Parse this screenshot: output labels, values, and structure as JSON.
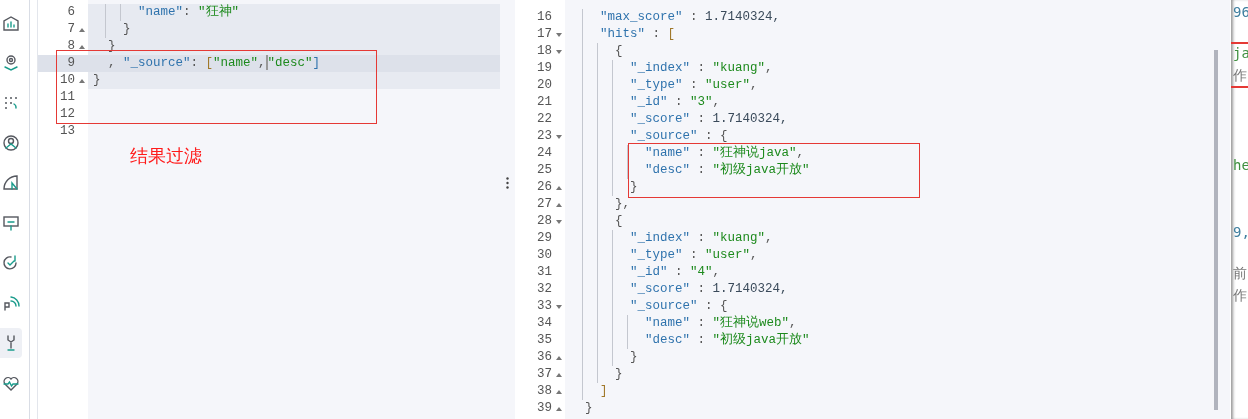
{
  "sidebar": {
    "items": [
      {
        "selected": false
      },
      {
        "selected": false
      },
      {
        "selected": false
      },
      {
        "selected": false
      },
      {
        "selected": false
      },
      {
        "selected": false
      },
      {
        "selected": false
      },
      {
        "selected": false
      },
      {
        "selected": true
      },
      {
        "selected": false
      }
    ]
  },
  "request_editor": {
    "lines": [
      {
        "number": "6",
        "in_request": true,
        "active": false,
        "tokens": [
          {
            "kind": "key",
            "text": "      \"name\""
          },
          {
            "kind": "punct",
            "text": ": "
          },
          {
            "kind": "string",
            "text": "\"狂神\""
          }
        ]
      },
      {
        "number": "7",
        "expanded": false,
        "in_request": true,
        "active": false,
        "tokens": [
          {
            "kind": "punct",
            "text": "    }"
          }
        ]
      },
      {
        "number": "8",
        "expanded": false,
        "in_request": true,
        "active": false,
        "tokens": [
          {
            "kind": "punct",
            "text": "  }"
          }
        ]
      },
      {
        "number": "9",
        "in_request": true,
        "active": true,
        "tokens": [
          {
            "kind": "punct",
            "text": "  , "
          },
          {
            "kind": "key",
            "text": "\"_source\""
          },
          {
            "kind": "punct",
            "text": ": "
          },
          {
            "kind": "bracket",
            "text": "["
          },
          {
            "kind": "string",
            "text": "\"name\""
          },
          {
            "kind": "punct",
            "text": ","
          },
          {
            "kind": "cursor"
          },
          {
            "kind": "string",
            "text": "\"desc\""
          },
          {
            "kind": "key",
            "text": "]"
          }
        ]
      },
      {
        "number": "10",
        "expanded": false,
        "in_request": true,
        "active": false,
        "tokens": [
          {
            "kind": "punct",
            "text": "}"
          }
        ]
      },
      {
        "number": "11",
        "in_request": false,
        "active": false
      },
      {
        "number": "12",
        "in_request": false,
        "active": false
      },
      {
        "number": "13",
        "in_request": false,
        "active": false
      }
    ],
    "note": "结果过滤"
  },
  "response_viewer": {
    "lines": [
      {
        "number": "16",
        "tokens": [
          {
            "kind": "key",
            "text": "    \"max_score\""
          },
          {
            "kind": "punct",
            "text": " : "
          },
          {
            "kind": "number",
            "text": "1.7140324,"
          }
        ]
      },
      {
        "number": "17",
        "expanded": true,
        "tokens": [
          {
            "kind": "key",
            "text": "    \"hits\""
          },
          {
            "kind": "punct",
            "text": " : "
          },
          {
            "kind": "bracket",
            "text": "["
          }
        ]
      },
      {
        "number": "18",
        "expanded": true,
        "tokens": [
          {
            "kind": "punct",
            "text": "      {"
          }
        ]
      },
      {
        "number": "19",
        "tokens": [
          {
            "kind": "key",
            "text": "        \"_index\""
          },
          {
            "kind": "punct",
            "text": " : "
          },
          {
            "kind": "string",
            "text": "\"kuang\""
          },
          {
            "kind": "punct",
            "text": ","
          }
        ]
      },
      {
        "number": "20",
        "tokens": [
          {
            "kind": "key",
            "text": "        \"_type\""
          },
          {
            "kind": "punct",
            "text": " : "
          },
          {
            "kind": "string",
            "text": "\"user\""
          },
          {
            "kind": "punct",
            "text": ","
          }
        ]
      },
      {
        "number": "21",
        "tokens": [
          {
            "kind": "key",
            "text": "        \"_id\""
          },
          {
            "kind": "punct",
            "text": " : "
          },
          {
            "kind": "string",
            "text": "\"3\""
          },
          {
            "kind": "punct",
            "text": ","
          }
        ]
      },
      {
        "number": "22",
        "tokens": [
          {
            "kind": "key",
            "text": "        \"_score\""
          },
          {
            "kind": "punct",
            "text": " : "
          },
          {
            "kind": "number",
            "text": "1.7140324,"
          }
        ]
      },
      {
        "number": "23",
        "expanded": true,
        "tokens": [
          {
            "kind": "key",
            "text": "        \"_source\""
          },
          {
            "kind": "punct",
            "text": " : {"
          }
        ]
      },
      {
        "number": "24",
        "tokens": [
          {
            "kind": "key",
            "text": "          \"name\""
          },
          {
            "kind": "punct",
            "text": " : "
          },
          {
            "kind": "string",
            "text": "\"狂神说java\""
          },
          {
            "kind": "punct",
            "text": ","
          }
        ]
      },
      {
        "number": "25",
        "tokens": [
          {
            "kind": "key",
            "text": "          \"desc\""
          },
          {
            "kind": "punct",
            "text": " : "
          },
          {
            "kind": "string",
            "text": "\"初级java开放\""
          }
        ]
      },
      {
        "number": "26",
        "expanded": false,
        "tokens": [
          {
            "kind": "punct",
            "text": "        }"
          }
        ]
      },
      {
        "number": "27",
        "expanded": false,
        "tokens": [
          {
            "kind": "punct",
            "text": "      },"
          }
        ]
      },
      {
        "number": "28",
        "expanded": true,
        "tokens": [
          {
            "kind": "punct",
            "text": "      {"
          }
        ]
      },
      {
        "number": "29",
        "tokens": [
          {
            "kind": "key",
            "text": "        \"_index\""
          },
          {
            "kind": "punct",
            "text": " : "
          },
          {
            "kind": "string",
            "text": "\"kuang\""
          },
          {
            "kind": "punct",
            "text": ","
          }
        ]
      },
      {
        "number": "30",
        "tokens": [
          {
            "kind": "key",
            "text": "        \"_type\""
          },
          {
            "kind": "punct",
            "text": " : "
          },
          {
            "kind": "string",
            "text": "\"user\""
          },
          {
            "kind": "punct",
            "text": ","
          }
        ]
      },
      {
        "number": "31",
        "tokens": [
          {
            "kind": "key",
            "text": "        \"_id\""
          },
          {
            "kind": "punct",
            "text": " : "
          },
          {
            "kind": "string",
            "text": "\"4\""
          },
          {
            "kind": "punct",
            "text": ","
          }
        ]
      },
      {
        "number": "32",
        "tokens": [
          {
            "kind": "key",
            "text": "        \"_score\""
          },
          {
            "kind": "punct",
            "text": " : "
          },
          {
            "kind": "number",
            "text": "1.7140324,"
          }
        ]
      },
      {
        "number": "33",
        "expanded": true,
        "tokens": [
          {
            "kind": "key",
            "text": "        \"_source\""
          },
          {
            "kind": "punct",
            "text": " : {"
          }
        ]
      },
      {
        "number": "34",
        "tokens": [
          {
            "kind": "key",
            "text": "          \"name\""
          },
          {
            "kind": "punct",
            "text": " : "
          },
          {
            "kind": "string",
            "text": "\"狂神说web\""
          },
          {
            "kind": "punct",
            "text": ","
          }
        ]
      },
      {
        "number": "35",
        "tokens": [
          {
            "kind": "key",
            "text": "          \"desc\""
          },
          {
            "kind": "punct",
            "text": " : "
          },
          {
            "kind": "string",
            "text": "\"初级java开放\""
          }
        ]
      },
      {
        "number": "36",
        "expanded": false,
        "tokens": [
          {
            "kind": "punct",
            "text": "        }"
          }
        ]
      },
      {
        "number": "37",
        "expanded": false,
        "tokens": [
          {
            "kind": "punct",
            "text": "      }"
          }
        ]
      },
      {
        "number": "38",
        "expanded": false,
        "tokens": [
          {
            "kind": "bracket",
            "text": "    ]"
          }
        ]
      },
      {
        "number": "39",
        "expanded": false,
        "tokens": [
          {
            "kind": "punct",
            "text": "  }"
          }
        ]
      }
    ]
  },
  "background_window": {
    "fragments": [
      {
        "kind": "code",
        "text": "96"
      },
      {
        "kind": "string",
        "text": "ja"
      },
      {
        "kind": "text",
        "text": "作"
      },
      {
        "kind": "string",
        "text": "he"
      },
      {
        "kind": "code",
        "text": "9,"
      },
      {
        "kind": "text",
        "text": "前"
      },
      {
        "kind": "text",
        "text": "作"
      }
    ]
  }
}
